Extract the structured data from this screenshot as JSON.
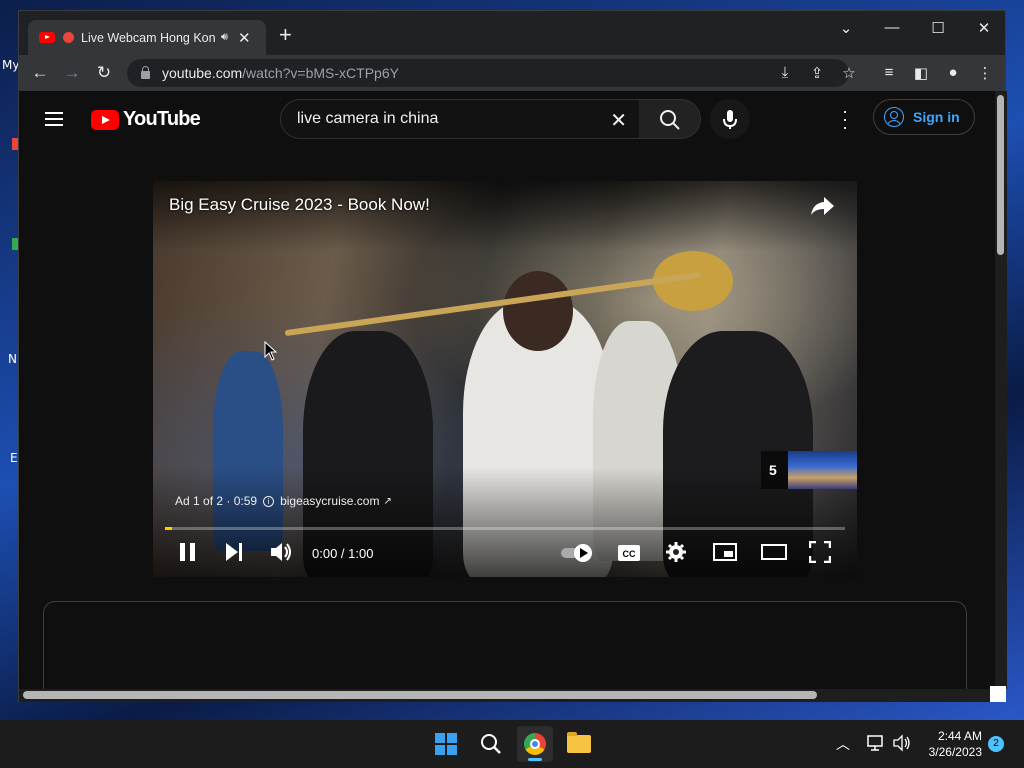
{
  "desktop": {
    "icon_labels": [
      "My",
      "N",
      "E"
    ]
  },
  "browser": {
    "tab": {
      "title": "Live Webcam Hong Kong",
      "favicon": "youtube-favicon",
      "recording": true,
      "audio_playing": true
    },
    "address": {
      "host": "youtube.com",
      "path": "/watch?v=bMS-xCTPp6Y"
    }
  },
  "youtube": {
    "logo_text": "YouTube",
    "search": {
      "value": "live camera in china"
    },
    "sign_in_label": "Sign in",
    "player": {
      "ad_title": "Big Easy Cruise 2023 - Book Now!",
      "ad_counter": "Ad 1 of 2 · 0:59",
      "advertiser": "bigeasycruise.com",
      "skip_countdown": "5",
      "time": "0:00 / 1:00",
      "progress_fraction": 0.01
    }
  },
  "taskbar": {
    "clock_time": "2:44 AM",
    "clock_date": "3/26/2023",
    "notification_count": "2"
  },
  "colors": {
    "youtube_red": "#ff0000",
    "link_blue": "#3ea6ff",
    "ad_progress": "#ffcc00"
  }
}
